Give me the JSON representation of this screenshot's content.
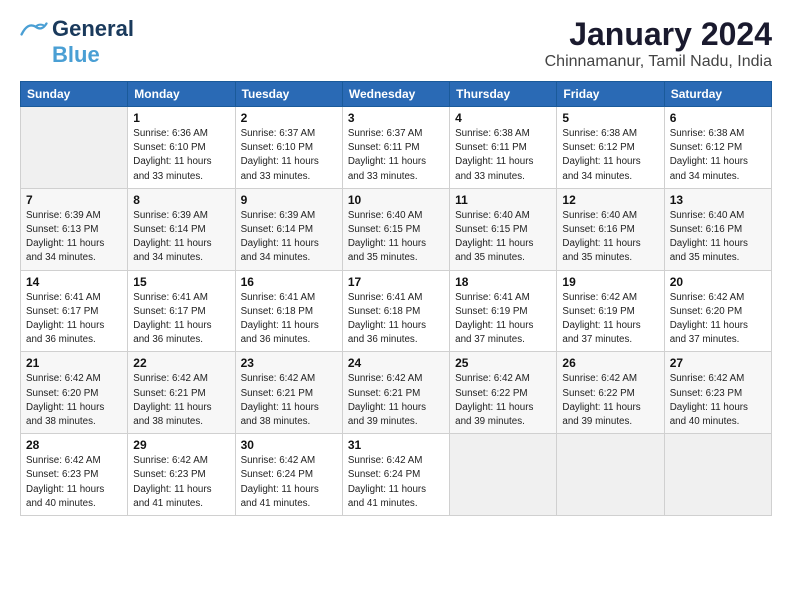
{
  "logo": {
    "line1": "General",
    "line2": "Blue"
  },
  "title": "January 2024",
  "subtitle": "Chinnamanur, Tamil Nadu, India",
  "days_of_week": [
    "Sunday",
    "Monday",
    "Tuesday",
    "Wednesday",
    "Thursday",
    "Friday",
    "Saturday"
  ],
  "weeks": [
    [
      {
        "day": "",
        "info": ""
      },
      {
        "day": "1",
        "info": "Sunrise: 6:36 AM\nSunset: 6:10 PM\nDaylight: 11 hours\nand 33 minutes."
      },
      {
        "day": "2",
        "info": "Sunrise: 6:37 AM\nSunset: 6:10 PM\nDaylight: 11 hours\nand 33 minutes."
      },
      {
        "day": "3",
        "info": "Sunrise: 6:37 AM\nSunset: 6:11 PM\nDaylight: 11 hours\nand 33 minutes."
      },
      {
        "day": "4",
        "info": "Sunrise: 6:38 AM\nSunset: 6:11 PM\nDaylight: 11 hours\nand 33 minutes."
      },
      {
        "day": "5",
        "info": "Sunrise: 6:38 AM\nSunset: 6:12 PM\nDaylight: 11 hours\nand 34 minutes."
      },
      {
        "day": "6",
        "info": "Sunrise: 6:38 AM\nSunset: 6:12 PM\nDaylight: 11 hours\nand 34 minutes."
      }
    ],
    [
      {
        "day": "7",
        "info": "Sunrise: 6:39 AM\nSunset: 6:13 PM\nDaylight: 11 hours\nand 34 minutes."
      },
      {
        "day": "8",
        "info": "Sunrise: 6:39 AM\nSunset: 6:14 PM\nDaylight: 11 hours\nand 34 minutes."
      },
      {
        "day": "9",
        "info": "Sunrise: 6:39 AM\nSunset: 6:14 PM\nDaylight: 11 hours\nand 34 minutes."
      },
      {
        "day": "10",
        "info": "Sunrise: 6:40 AM\nSunset: 6:15 PM\nDaylight: 11 hours\nand 35 minutes."
      },
      {
        "day": "11",
        "info": "Sunrise: 6:40 AM\nSunset: 6:15 PM\nDaylight: 11 hours\nand 35 minutes."
      },
      {
        "day": "12",
        "info": "Sunrise: 6:40 AM\nSunset: 6:16 PM\nDaylight: 11 hours\nand 35 minutes."
      },
      {
        "day": "13",
        "info": "Sunrise: 6:40 AM\nSunset: 6:16 PM\nDaylight: 11 hours\nand 35 minutes."
      }
    ],
    [
      {
        "day": "14",
        "info": "Sunrise: 6:41 AM\nSunset: 6:17 PM\nDaylight: 11 hours\nand 36 minutes."
      },
      {
        "day": "15",
        "info": "Sunrise: 6:41 AM\nSunset: 6:17 PM\nDaylight: 11 hours\nand 36 minutes."
      },
      {
        "day": "16",
        "info": "Sunrise: 6:41 AM\nSunset: 6:18 PM\nDaylight: 11 hours\nand 36 minutes."
      },
      {
        "day": "17",
        "info": "Sunrise: 6:41 AM\nSunset: 6:18 PM\nDaylight: 11 hours\nand 36 minutes."
      },
      {
        "day": "18",
        "info": "Sunrise: 6:41 AM\nSunset: 6:19 PM\nDaylight: 11 hours\nand 37 minutes."
      },
      {
        "day": "19",
        "info": "Sunrise: 6:42 AM\nSunset: 6:19 PM\nDaylight: 11 hours\nand 37 minutes."
      },
      {
        "day": "20",
        "info": "Sunrise: 6:42 AM\nSunset: 6:20 PM\nDaylight: 11 hours\nand 37 minutes."
      }
    ],
    [
      {
        "day": "21",
        "info": "Sunrise: 6:42 AM\nSunset: 6:20 PM\nDaylight: 11 hours\nand 38 minutes."
      },
      {
        "day": "22",
        "info": "Sunrise: 6:42 AM\nSunset: 6:21 PM\nDaylight: 11 hours\nand 38 minutes."
      },
      {
        "day": "23",
        "info": "Sunrise: 6:42 AM\nSunset: 6:21 PM\nDaylight: 11 hours\nand 38 minutes."
      },
      {
        "day": "24",
        "info": "Sunrise: 6:42 AM\nSunset: 6:21 PM\nDaylight: 11 hours\nand 39 minutes."
      },
      {
        "day": "25",
        "info": "Sunrise: 6:42 AM\nSunset: 6:22 PM\nDaylight: 11 hours\nand 39 minutes."
      },
      {
        "day": "26",
        "info": "Sunrise: 6:42 AM\nSunset: 6:22 PM\nDaylight: 11 hours\nand 39 minutes."
      },
      {
        "day": "27",
        "info": "Sunrise: 6:42 AM\nSunset: 6:23 PM\nDaylight: 11 hours\nand 40 minutes."
      }
    ],
    [
      {
        "day": "28",
        "info": "Sunrise: 6:42 AM\nSunset: 6:23 PM\nDaylight: 11 hours\nand 40 minutes."
      },
      {
        "day": "29",
        "info": "Sunrise: 6:42 AM\nSunset: 6:23 PM\nDaylight: 11 hours\nand 41 minutes."
      },
      {
        "day": "30",
        "info": "Sunrise: 6:42 AM\nSunset: 6:24 PM\nDaylight: 11 hours\nand 41 minutes."
      },
      {
        "day": "31",
        "info": "Sunrise: 6:42 AM\nSunset: 6:24 PM\nDaylight: 11 hours\nand 41 minutes."
      },
      {
        "day": "",
        "info": ""
      },
      {
        "day": "",
        "info": ""
      },
      {
        "day": "",
        "info": ""
      }
    ]
  ]
}
